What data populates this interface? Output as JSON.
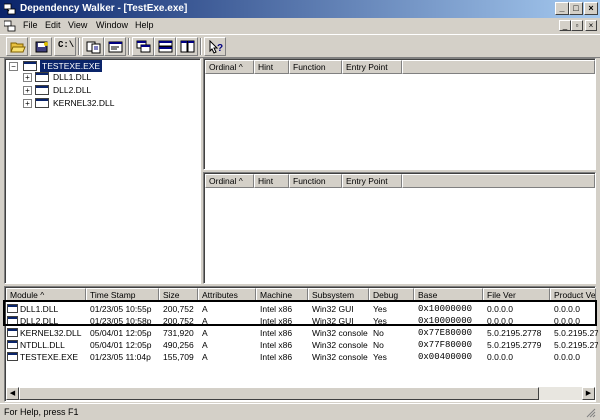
{
  "window": {
    "title": "Dependency Walker - [TestExe.exe]",
    "buttons": {
      "minimize": "_",
      "maximize": "□",
      "close": "×"
    }
  },
  "menu": {
    "items": [
      "File",
      "Edit",
      "View",
      "Window",
      "Help"
    ],
    "mdi": {
      "minimize": "_",
      "restore": "▫",
      "close": "×"
    }
  },
  "toolbar": {
    "buttons": [
      "open-folder-icon",
      "save-icon",
      "command-prompt-icon",
      "copy-icon",
      "cascade-windows-icon",
      "tile-horizontal-icon",
      "tile-vertical-icon",
      "whats-this-help-icon"
    ],
    "cmd_label": "C:\\"
  },
  "tree": {
    "root": "TESTEXE.EXE",
    "children": [
      "DLL1.DLL",
      "DLL2.DLL",
      "KERNEL32.DLL"
    ],
    "expander": "+"
  },
  "function_columns": [
    "Ordinal ^",
    "Hint",
    "Function",
    "Entry Point"
  ],
  "modules": {
    "columns": [
      "Module ^",
      "Time Stamp",
      "Size",
      "Attributes",
      "Machine",
      "Subsystem",
      "Debug",
      "Base",
      "File Ver",
      "Product Ver"
    ],
    "rows": [
      [
        "DLL1.DLL",
        "01/23/05  10:55p",
        "200,752",
        "A",
        "Intel x86",
        "Win32 GUI",
        "Yes",
        "0x10000000",
        "0.0.0.0",
        "0.0.0.0"
      ],
      [
        "DLL2.DLL",
        "01/23/05  10:58p",
        "200,752",
        "A",
        "Intel x86",
        "Win32 GUI",
        "Yes",
        "0x10000000",
        "0.0.0.0",
        "0.0.0.0"
      ],
      [
        "KERNEL32.DLL",
        "05/04/01  12:05p",
        "731,920",
        "A",
        "Intel x86",
        "Win32 console",
        "No",
        "0x77E80000",
        "5.0.2195.2778",
        "5.0.2195.27"
      ],
      [
        "NTDLL.DLL",
        "05/04/01  12:05p",
        "490,256",
        "A",
        "Intel x86",
        "Win32 console",
        "No",
        "0x77F80000",
        "5.0.2195.2779",
        "5.0.2195.27"
      ],
      [
        "TESTEXE.EXE",
        "01/23/05  11:04p",
        "155,709",
        "A",
        "Intel x86",
        "Win32 console",
        "Yes",
        "0x00400000",
        "0.0.0.0",
        "0.0.0.0"
      ]
    ]
  },
  "status": {
    "text": "For Help, press F1"
  }
}
